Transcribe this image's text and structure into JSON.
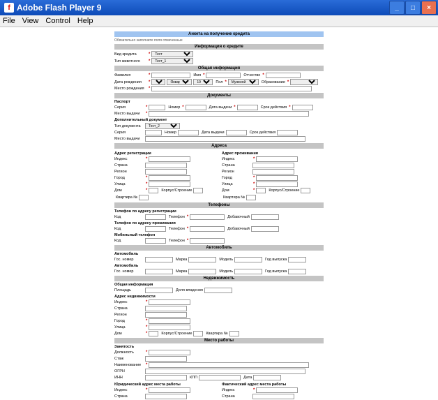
{
  "window": {
    "title": "Adobe Flash Player 9"
  },
  "menu": {
    "file": "File",
    "view": "View",
    "control": "Control",
    "help": "Help"
  },
  "s": {
    "h0": "Анкета на получение кредита",
    "note": "Обязательно заполните поля отмеченные",
    "h1": "Информация о кредите",
    "vid": "Вид кредита",
    "tipz": "Тип животного",
    "test": "Тест",
    "test1": "Тест_1",
    "h2": "Общая информация",
    "fam": "Фамилия",
    "imya": "Имя",
    "otch": "Отчество",
    "dr": "Дата рождения",
    "pol": "Пол",
    "muzh": "Мужской",
    "obr": "Образование",
    "yan": "Январь",
    "mr": "Место рождения",
    "h3": "Документы",
    "pasp": "Паспорт",
    "ser": "Серия",
    "nom": "Номер",
    "dv": "Дата выдачи",
    "sd": "Срок действия",
    "mv": "Место выдачи",
    "dop": "Дополнительный документ",
    "tdok": "Тип документа",
    "test2": "Тест_2",
    "h4": "Адреса",
    "areg": "Адрес регистрации",
    "aproz": "Адрес проживания",
    "idx": "Индекс",
    "str": "Страна",
    "reg": "Регион",
    "gor": "Город",
    "ul": "Улица",
    "dom": "Дом",
    "ks": "Корпус/Строение",
    "kv": "Квартира №",
    "h5": "Телефоны",
    "treg": "Телефон по адресу регистрации",
    "tproz": "Телефон по адресу проживания",
    "mob": "Мобильный телефон",
    "kod": "Код",
    "tel": "Телефон",
    "dob": "Добавочный",
    "h6": "Автомобиль",
    "auto": "Автомобиль",
    "gos": "Гос. номер",
    "marka": "Марка",
    "model": "Модель",
    "gv": "Год выпуска",
    "h7": "Недвижимость",
    "obsh": "Общая информация",
    "pl": "Площадь",
    "dvl": "Доля владения",
    "adrn": "Адрес недвижимости",
    "h8": "Место работы",
    "zan": "Занятость",
    "dol": "Должность",
    "staz": "Стаж",
    "naim": "Наименование",
    "ogrn": "ОГРН",
    "inn": "ИНН",
    "kpp": "КПП",
    "data": "Дата",
    "yur": "Юридический адрес места работы",
    "fakt": "Фактический адрес места работы"
  }
}
